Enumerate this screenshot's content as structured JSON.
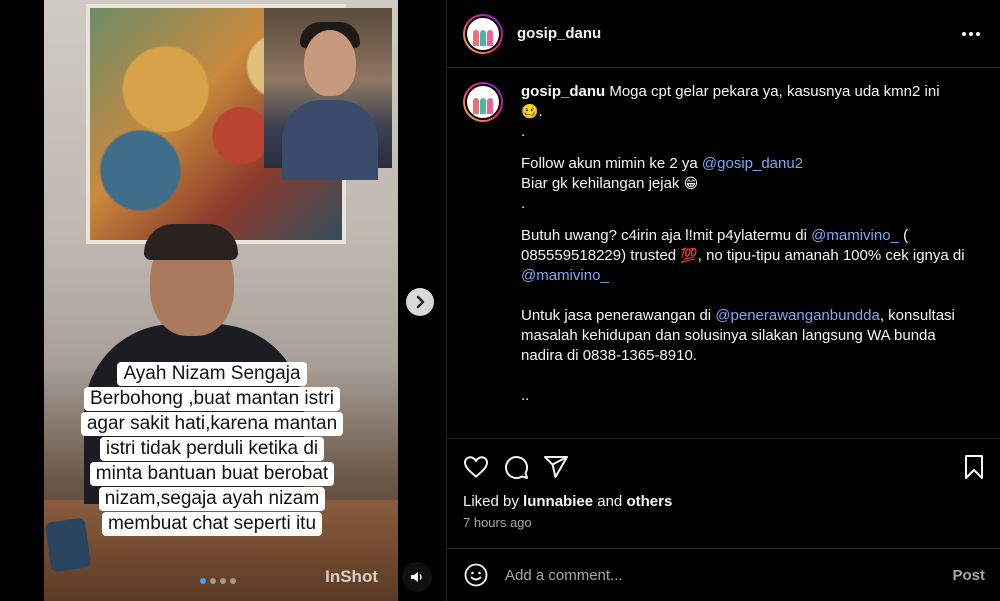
{
  "media": {
    "overlay_caption_lines": [
      "Ayah Nizam Sengaja",
      "Berbohong ,buat mantan istri",
      "agar sakit hati,karena mantan",
      "istri tidak perduli ketika di",
      "minta bantuan buat berobat",
      "nizam,segaja ayah nizam",
      "membuat chat seperti itu"
    ],
    "watermark": "InShot",
    "carousel_count": 4,
    "carousel_active_index": 0,
    "icons": {
      "next": "chevron-right-icon",
      "volume": "speaker-icon"
    }
  },
  "header": {
    "username": "gosip_danu",
    "more_icon": "more-horizontal-icon"
  },
  "caption": {
    "username": "gosip_danu",
    "line1": "Moga cpt gelar pekara ya, kasusnya uda kmn2 ini",
    "emoji1": "🥴",
    "dot1": ".",
    "dot2": ".",
    "follow_text": "Follow akun mimin ke 2 ya ",
    "follow_mention": "@gosip_danu2",
    "biar_text": "Biar gk kehilangan jejak ",
    "emoji2": "😁",
    "dot3": ".",
    "butuh_text": "Butuh uwang? c4irin aja l!mit p4ylatermu di ",
    "butuh_mention": "@mamivino_",
    "butuh_text2": " ( 085559518229) trusted ",
    "emoji3": "💯",
    "butuh_text3": ", no tipu-tipu amanah 100% cek ignya di ",
    "butuh_mention2": "@mamivino_",
    "jasa_text": "Untuk jasa penerawangan di ",
    "jasa_mention": "@penerawanganbundda",
    "jasa_text2": ", konsultasi masalah kehidupan dan solusinya silakan langsung WA bunda nadira di 0838-1365-8910.",
    "dots_end": ".."
  },
  "actions": {
    "icons": [
      "heart-icon",
      "comment-icon",
      "share-icon",
      "bookmark-icon"
    ],
    "liked_by_prefix": "Liked by ",
    "liked_by_user": "lunnabiee",
    "liked_by_mid": " and ",
    "liked_by_others": "others",
    "timestamp": "7 hours ago"
  },
  "comment_box": {
    "placeholder": "Add a comment...",
    "post_label": "Post",
    "emoji_icon": "smiley-icon"
  },
  "colors": {
    "mention": "#7ea6f2",
    "background": "#000000",
    "divider": "#262626",
    "secondary_text": "#a8a8a8"
  }
}
